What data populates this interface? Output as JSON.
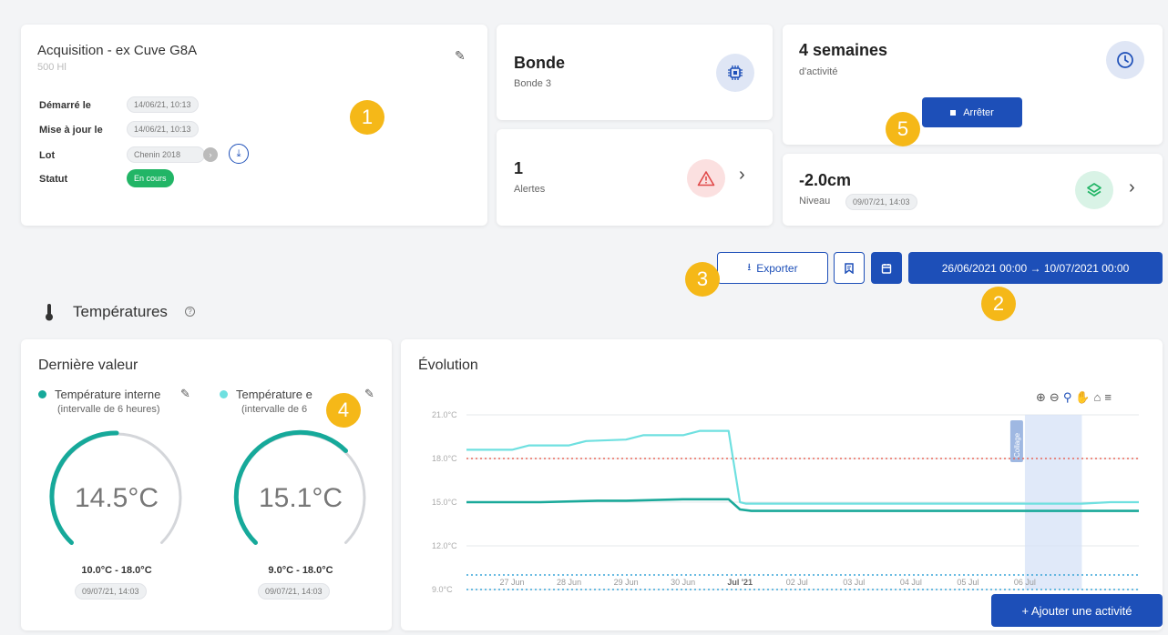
{
  "acquisition": {
    "title": "Acquisition - ex Cuve G8A",
    "subtitle": "500 Hl",
    "started_label": "Démarré le",
    "started_value": "14/06/21, 10:13",
    "updated_label": "Mise à jour le",
    "updated_value": "14/06/21, 10:13",
    "lot_label": "Lot",
    "lot_value": "Chenin 2018",
    "status_label": "Statut",
    "status_value": "En cours"
  },
  "bonde": {
    "title": "Bonde",
    "subtitle": "Bonde 3"
  },
  "alertes": {
    "count": "1",
    "label": "Alertes"
  },
  "activity": {
    "title": "4 semaines",
    "subtitle": "d'activité",
    "stop_label": "Arrêter"
  },
  "niveau": {
    "value": "-2.0cm",
    "label": "Niveau",
    "timestamp": "09/07/21, 14:03"
  },
  "toolbar": {
    "export_label": "Exporter",
    "date_range": "26/06/2021 00:00 → 10/07/2021 00:00"
  },
  "section": {
    "title": "Températures"
  },
  "last_value": {
    "title": "Dernière valeur",
    "sensors": [
      {
        "name": "Température interne",
        "interval": "(intervalle de 6 heures)",
        "value": "14.5°C",
        "range": "10.0°C - 18.0°C",
        "timestamp": "09/07/21, 14:03",
        "fill": 0.5,
        "color": "#16a99a"
      },
      {
        "name": "Température e",
        "interval": "(intervalle de 6",
        "value": "15.1°C",
        "range": "9.0°C - 18.0°C",
        "timestamp": "09/07/21, 14:03",
        "fill": 0.67,
        "color": "#16a99a"
      }
    ]
  },
  "evolution": {
    "title": "Évolution",
    "add_activity_label": "+ Ajouter une activité",
    "annotation": "Collage"
  },
  "badges": [
    "1",
    "2",
    "3",
    "4",
    "5"
  ],
  "colors": {
    "primary": "#1d4fb8",
    "teal_dark": "#1aa99a",
    "teal_light": "#6fe0e0",
    "limit_red": "#e8685c",
    "limit_blue": "#3aa6d8",
    "badge": "#f5b818"
  },
  "chart_data": {
    "type": "line",
    "title": "",
    "y_ticks": [
      "21.0°C",
      "18.0°C",
      "15.0°C",
      "12.0°C",
      "9.0°C"
    ],
    "ylim": [
      9,
      21
    ],
    "x_ticks": [
      "27 Jun",
      "28 Jun",
      "29 Jun",
      "30 Jun",
      "Jul '21",
      "02 Jul",
      "03 Jul",
      "04 Jul",
      "05 Jul",
      "06 Jul"
    ],
    "series": [
      {
        "color": "#6fe0e0",
        "x": [
          26.2,
          27.0,
          27.3,
          28.0,
          28.3,
          29.0,
          29.3,
          30.0,
          30.3,
          30.8,
          31.0,
          31.1,
          32.0,
          34.0,
          36.0,
          37.0,
          37.5,
          38.0
        ],
        "y": [
          18.6,
          18.6,
          18.9,
          18.9,
          19.2,
          19.3,
          19.6,
          19.6,
          19.9,
          19.9,
          15.0,
          14.9,
          14.9,
          14.9,
          14.9,
          14.9,
          15.0,
          15.0
        ]
      },
      {
        "color": "#1aa99a",
        "x": [
          26.2,
          27.5,
          28.5,
          29.0,
          30.0,
          30.8,
          31.0,
          31.2,
          33.0,
          35.0,
          37.0,
          38.0
        ],
        "y": [
          15.0,
          15.0,
          15.1,
          15.1,
          15.2,
          15.2,
          14.5,
          14.4,
          14.4,
          14.4,
          14.4,
          14.4
        ]
      }
    ],
    "limits": [
      {
        "y": 18.0,
        "color": "#e8685c"
      },
      {
        "y": 10.0,
        "color": "#3aa6d8"
      },
      {
        "y": 9.0,
        "color": "#3aa6d8"
      }
    ],
    "annotation_band": {
      "label": "Collage",
      "x_start": 36.0,
      "x_end": 37.0
    },
    "grid": true
  }
}
